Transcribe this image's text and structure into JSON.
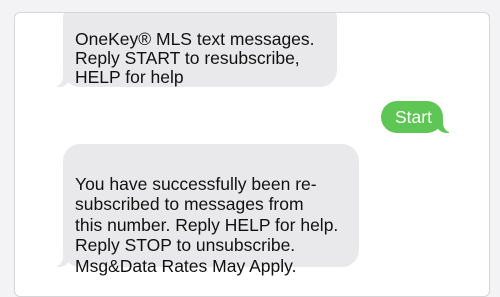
{
  "conversation": {
    "messages": [
      {
        "direction": "incoming",
        "text": "OneKey® MLS text messages.\nReply START to resubscribe,\nHELP for help"
      },
      {
        "direction": "outgoing",
        "text": "Start"
      },
      {
        "direction": "incoming",
        "text": "You have successfully been re-\nsubscribed to messages from\nthis number. Reply HELP for help.\nReply STOP to unsubscribe.\nMsg&Data Rates May Apply."
      }
    ]
  },
  "colors": {
    "incoming_bubble": "#e9e9eb",
    "outgoing_bubble": "#5ec654",
    "background": "#ffffff"
  }
}
